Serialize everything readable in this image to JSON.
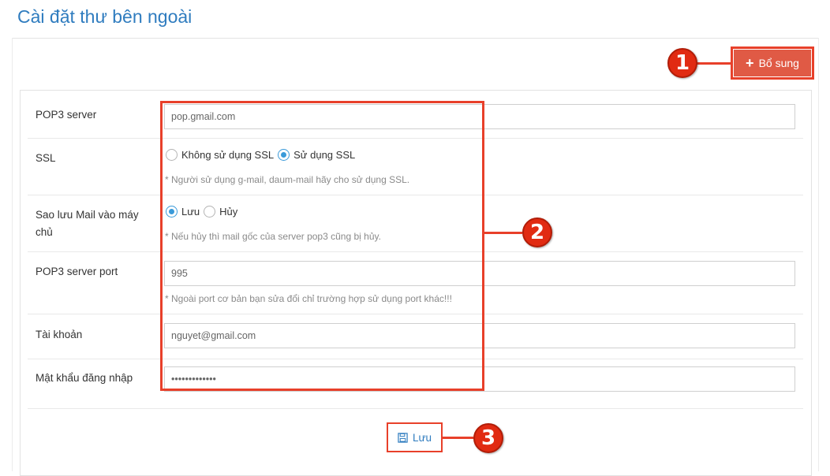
{
  "page": {
    "title": "Cài đặt thư bên ngoài"
  },
  "toolbar": {
    "add_label": "Bổ sung",
    "add_icon": "plus-icon"
  },
  "form": {
    "pop3_server": {
      "label": "POP3 server",
      "value": "pop.gmail.com"
    },
    "ssl": {
      "label": "SSL",
      "options": [
        "Không sử dụng SSL",
        "Sử dụng SSL"
      ],
      "selected": "Sử dụng SSL",
      "hint": "* Người sử dụng g-mail, daum-mail hãy cho sử dụng SSL."
    },
    "backup": {
      "label": "Sao lưu Mail vào máy chủ",
      "options": [
        "Lưu",
        "Hủy"
      ],
      "selected": "Lưu",
      "hint": "* Nếu hủy thì mail gốc của server pop3 cũng bị hủy."
    },
    "port": {
      "label": "POP3 server port",
      "value": "995",
      "hint": "* Ngoài port cơ bản bạn sửa đổi chỉ trường hợp sử dụng port khác!!!"
    },
    "account": {
      "label": "Tài khoản",
      "value": "nguyet@gmail.com"
    },
    "password": {
      "label": "Mật khẩu đăng nhập",
      "value": "•••••••••••••"
    }
  },
  "save": {
    "label": "Lưu",
    "icon": "floppy-disk-icon"
  },
  "callouts": [
    "1",
    "2",
    "3"
  ],
  "colors": {
    "accent": "#2f7cbf",
    "button": "#e05a45",
    "callout": "#e8402a",
    "radio": "#3a9ad9"
  }
}
